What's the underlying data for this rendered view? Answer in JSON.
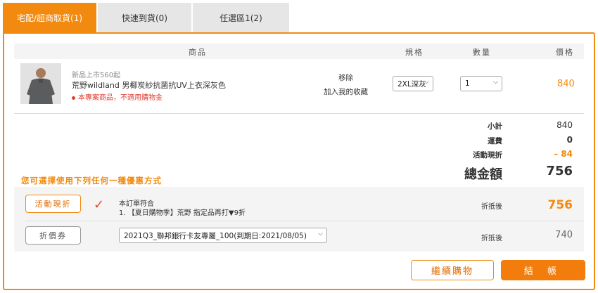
{
  "tabs": [
    {
      "label": "宅配/超商取貨(1)",
      "active": true
    },
    {
      "label": "快速到貨(0)",
      "active": false
    },
    {
      "label": "任選區1(2)",
      "active": false
    }
  ],
  "table": {
    "headers": [
      "商品",
      "規格",
      "數量",
      "價格"
    ]
  },
  "item": {
    "image": "product-photo",
    "tag": "新品上市560起",
    "name": "荒野wildland 男椰炭紗抗菌抗UV上衣深灰色",
    "note": "本專案商品，不適用購物金",
    "remove": "移除",
    "favorite": "加入我的收藏",
    "spec": "2XL深灰",
    "qty": "1",
    "price": "840"
  },
  "summary": {
    "subtotal_label": "小計",
    "subtotal": "840",
    "shipping_label": "運費",
    "shipping": "0",
    "discount_label": "活動現折",
    "discount": "– 84",
    "total_label": "總金額",
    "total": "756"
  },
  "discounts": {
    "prompt": "您可選擇使用下列任何一種優惠方式",
    "event": {
      "button": "活動現折",
      "line1": "本訂單符合",
      "line2": "1. 【夏日購物季】荒野 指定品再打▼9折",
      "after_label": "折抵後",
      "after_value": "756"
    },
    "coupon": {
      "button": "折價券",
      "selected": "2021Q3_聯邦銀行卡友專屬_100(到期日:2021/08/05)",
      "after_label": "折抵後",
      "after_value": "740"
    }
  },
  "actions": {
    "continue": "繼續購物",
    "checkout": "結 帳"
  },
  "colors": {
    "accent": "#f28a10",
    "warning": "#e03c2f"
  }
}
